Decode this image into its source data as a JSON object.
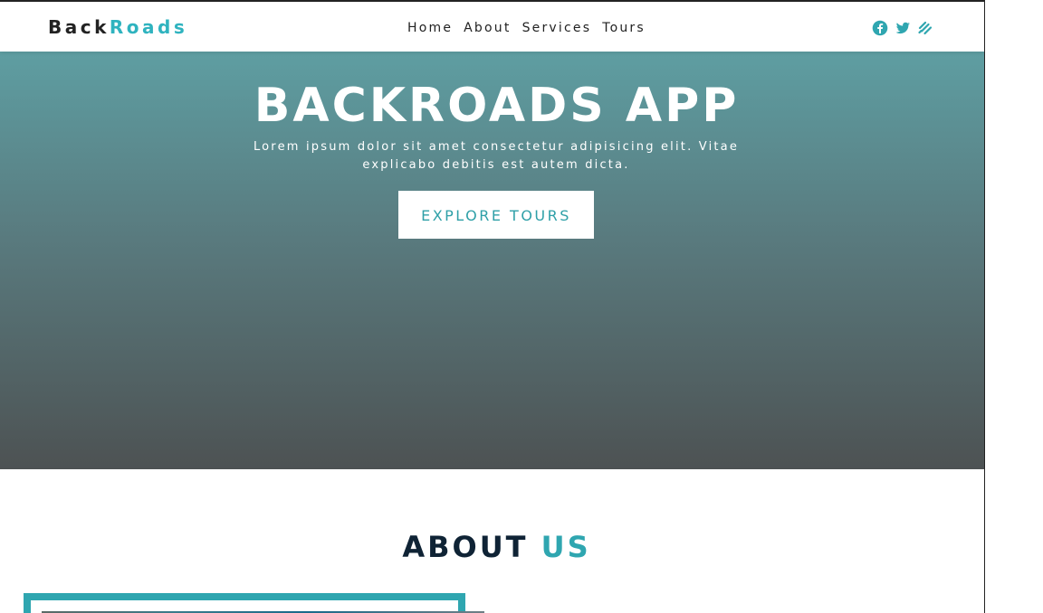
{
  "header": {
    "logo_part_a": "Back",
    "logo_part_b": "Roads",
    "nav_links": [
      "Home",
      "About",
      "Services",
      "Tours"
    ],
    "social_icons": [
      "facebook-icon",
      "twitter-icon",
      "squarespace-icon"
    ]
  },
  "hero": {
    "title": "BACKROADS APP",
    "text": "Lorem ipsum dolor sit amet consectetur adipisicing elit. Vitae explicabo debitis est autem dicta.",
    "button_label": "EXPLORE TOURS"
  },
  "about": {
    "title_part_a": "ABOUT",
    "title_part_b": "US"
  },
  "colors": {
    "accent": "#2fb3bf",
    "dark": "#222222",
    "heading_dark": "#0f2335"
  }
}
